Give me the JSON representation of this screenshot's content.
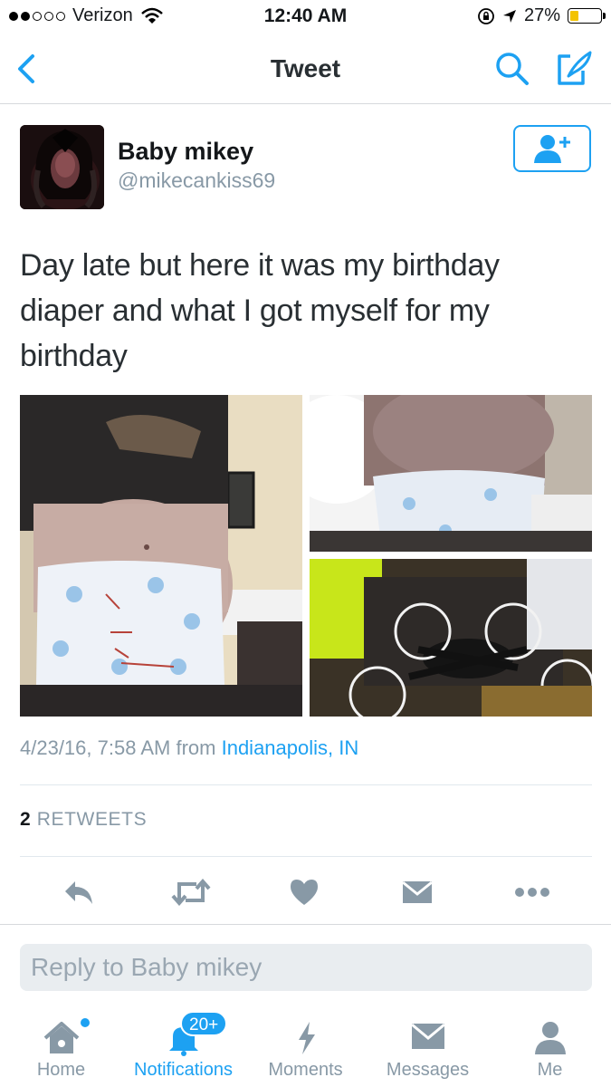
{
  "status_bar": {
    "carrier": "Verizon",
    "time": "12:40 AM",
    "battery": "27%",
    "battery_level": 0.27
  },
  "nav": {
    "title": "Tweet",
    "back_icon": "chevron-left-icon",
    "search_icon": "search-icon",
    "compose_icon": "compose-icon"
  },
  "tweet": {
    "name": "Baby mikey",
    "handle": "@mikecankiss69",
    "text": "Day late but here it was my birthday diaper and what I got myself for my birthday",
    "timestamp": "4/23/16, 7:58 AM from",
    "location": "Indianapolis, IN",
    "retweet_count": "2",
    "retweet_label": "RETWEETS"
  },
  "reply": {
    "placeholder": "Reply to Baby mikey"
  },
  "tabs": [
    {
      "label": "Home",
      "icon": "home-icon"
    },
    {
      "label": "Notifications",
      "icon": "bell-icon",
      "badge": "20+"
    },
    {
      "label": "Moments",
      "icon": "lightning-icon"
    },
    {
      "label": "Messages",
      "icon": "envelope-icon"
    },
    {
      "label": "Me",
      "icon": "person-icon"
    }
  ],
  "colors": {
    "accent": "#1da1f2",
    "muted": "#8899a6",
    "text": "#14171a"
  }
}
